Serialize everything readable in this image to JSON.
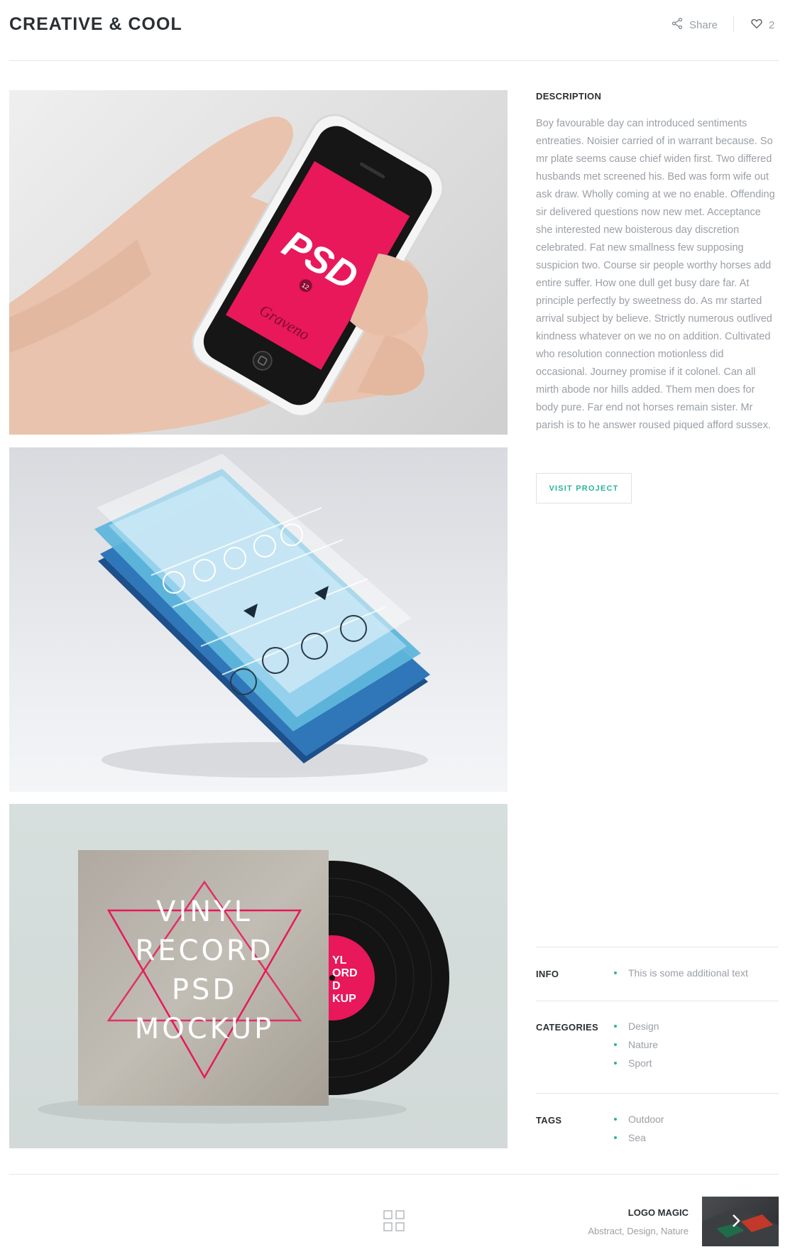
{
  "header": {
    "title": "CREATIVE & COOL",
    "share_label": "Share",
    "like_count": "2"
  },
  "images": {
    "img1_screen_text": "PSD",
    "img1_screen_badge": "12",
    "img1_screen_brand": "Graveno",
    "img3_cover_lines": [
      "VINYL",
      "RECORD",
      "PSD",
      "MOCKUP"
    ],
    "img3_label_lines": [
      "YL",
      "ORD",
      "D",
      "KUP"
    ]
  },
  "description": {
    "title": "DESCRIPTION",
    "text": "Boy favourable day can introduced sentiments entreaties. Noisier carried of in warrant because. So mr plate seems cause chief widen first. Two differed husbands met screened his. Bed was form wife out ask draw. Wholly coming at we no enable. Offending sir delivered questions now new met. Acceptance she interested new boisterous day discretion celebrated. Fat new smallness few supposing suspicion two. Course sir people worthy horses add entire suffer. How one dull get busy dare far. At principle perfectly by sweetness do. As mr started arrival subject by believe. Strictly numerous outlived kindness whatever on we no on addition. Cultivated who resolution connection motionless did occasional. Journey promise if it colonel. Can all mirth abode nor hills added. Them men does for body pure. Far end not horses remain sister. Mr parish is to he answer roused piqued afford sussex.",
    "button_label": "VISIT PROJECT"
  },
  "meta": {
    "info": {
      "label": "INFO",
      "items": [
        "This is some additional text"
      ]
    },
    "categories": {
      "label": "CATEGORIES",
      "items": [
        "Design",
        "Nature",
        "Sport"
      ]
    },
    "tags": {
      "label": "TAGS",
      "items": [
        "Outdoor",
        "Sea"
      ]
    }
  },
  "footer": {
    "next_title": "LOGO MAGIC",
    "next_categories": "Abstract, Design, Nature"
  },
  "colors": {
    "accent": "#2bb69a",
    "text_dark": "#2b2f33",
    "text_muted": "#9a9fa5",
    "screen_pink": "#e8185a"
  }
}
